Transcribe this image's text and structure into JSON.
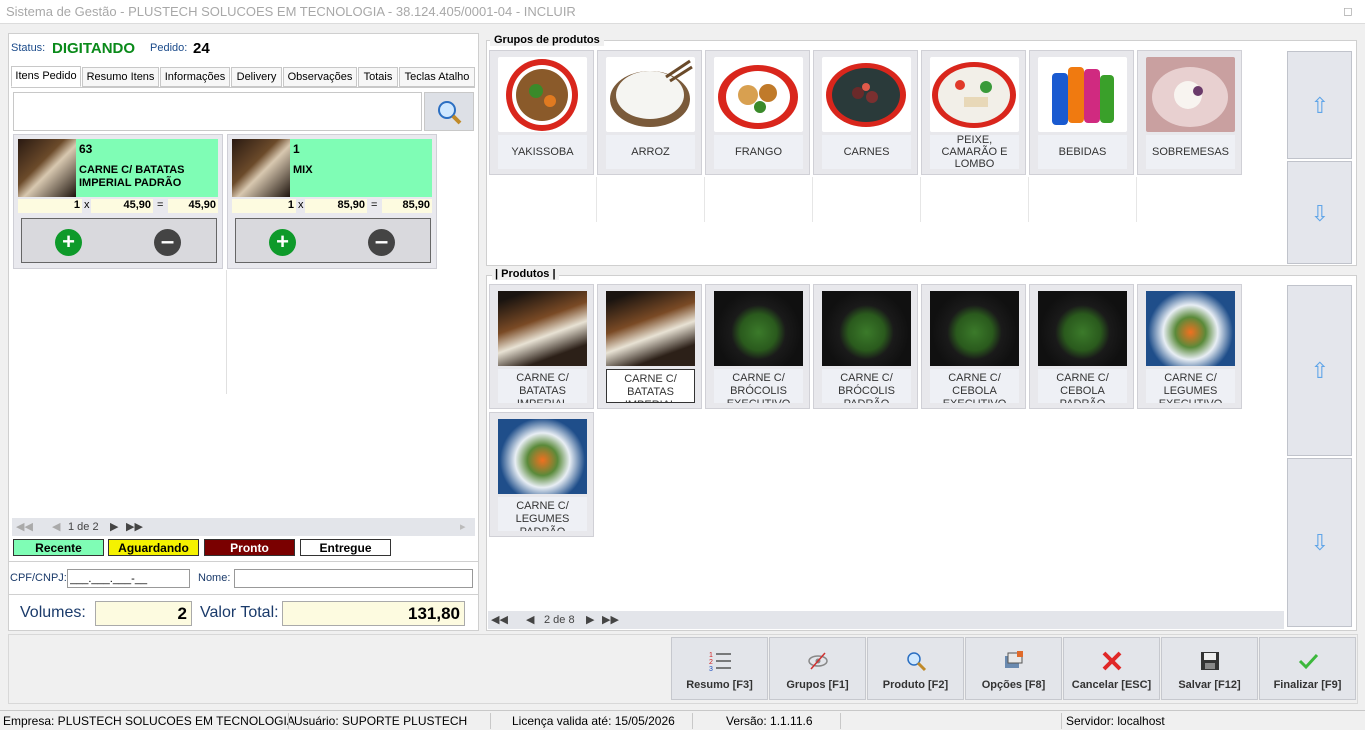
{
  "window": {
    "title": "Sistema de Gestão - PLUSTECH SOLUCOES EM TECNOLOGIA - 38.124.405/0001-04 - INCLUIR"
  },
  "order": {
    "status_label": "Status:",
    "status": "DIGITANDO",
    "pedido_label": "Pedido:",
    "pedido": "24"
  },
  "tabs": [
    "Itens Pedido",
    "Resumo Itens",
    "Informações",
    "Delivery",
    "Observações",
    "Totais",
    "Teclas Atalho"
  ],
  "search": {
    "value": "",
    "placeholder": ""
  },
  "items": [
    {
      "count": "63",
      "name": "CARNE C/ BATATAS IMPERIAL PADRÃO",
      "qty": "1",
      "x": "x",
      "price": "45,90",
      "eq": "=",
      "total": "45,90"
    },
    {
      "count": "1",
      "name": "MIX",
      "qty": "1",
      "x": "x",
      "price": "85,90",
      "eq": "=",
      "total": "85,90"
    }
  ],
  "item_pager": {
    "text": "1 de 2"
  },
  "legend": [
    {
      "label": "Recente",
      "color": "#7ffdb5",
      "text_color": "#000000"
    },
    {
      "label": "Aguardando",
      "color": "#f5f200",
      "text_color": "#000000"
    },
    {
      "label": "Pronto",
      "color": "#7a0000",
      "text_color": "#ffffff"
    },
    {
      "label": "Entregue",
      "color": "#ffffff",
      "text_color": "#000000"
    }
  ],
  "customer": {
    "cpf_label": "CPF/CNPJ:",
    "cpf_value": "___.___.___-__",
    "nome_label": "Nome:",
    "nome_value": ""
  },
  "totals": {
    "volumes_label": "Volumes:",
    "volumes": "2",
    "valor_label": "Valor Total:",
    "valor": "131,80"
  },
  "groups": {
    "title": "Grupos de produtos",
    "items": [
      {
        "label": "YAKISSOBA",
        "icon": "yakissoba-image"
      },
      {
        "label": "ARROZ",
        "icon": "rice-image"
      },
      {
        "label": "FRANGO",
        "icon": "chicken-image"
      },
      {
        "label": "CARNES",
        "icon": "meat-image"
      },
      {
        "label": "PEIXE, CAMARÃO E LOMBO",
        "icon": "fish-image"
      },
      {
        "label": "BEBIDAS",
        "icon": "drinks-image"
      },
      {
        "label": "SOBREMESAS",
        "icon": "dessert-image"
      }
    ]
  },
  "products": {
    "title": "| Produtos |",
    "items": [
      {
        "label": "CARNE C/ BATATAS IMPERIAL",
        "img": "food1"
      },
      {
        "label": "CARNE C/ BATATAS IMPERIAL",
        "img": "food1"
      },
      {
        "label": "CARNE C/ BRÓCOLIS EXECUTIVO",
        "img": "food2"
      },
      {
        "label": "CARNE C/ BRÓCOLIS PADRÃO",
        "img": "food2"
      },
      {
        "label": "CARNE C/ CEBOLA EXECUTIVO",
        "img": "food2"
      },
      {
        "label": "CARNE C/ CEBOLA PADRÃO",
        "img": "food2"
      },
      {
        "label": "CARNE C/ LEGUMES EXECUTIVO",
        "img": "food3"
      },
      {
        "label": "CARNE C/ LEGUMES PADRÃO",
        "img": "food3"
      }
    ],
    "pager": "2 de 8"
  },
  "toolbar": [
    {
      "label": "Resumo [F3]",
      "icon": "numbered-list-icon"
    },
    {
      "label": "Grupos [F1]",
      "icon": "hidden-eye-icon"
    },
    {
      "label": "Produto [F2]",
      "icon": "magnifier-icon"
    },
    {
      "label": "Opções [F8]",
      "icon": "options-icon"
    },
    {
      "label": "Cancelar [ESC]",
      "icon": "cancel-x-icon"
    },
    {
      "label": "Salvar [F12]",
      "icon": "floppy-icon"
    },
    {
      "label": "Finalizar [F9]",
      "icon": "checkmark-icon"
    }
  ],
  "statusbar": {
    "empresa": "Empresa: PLUSTECH SOLUCOES EM TECNOLOGIA",
    "usuario": "Usuário: SUPORTE PLUSTECH",
    "licenca": "Licença valida até: 15/05/2026",
    "versao": "Versão: 1.1.11.6",
    "servidor": "Servidor: localhost"
  }
}
